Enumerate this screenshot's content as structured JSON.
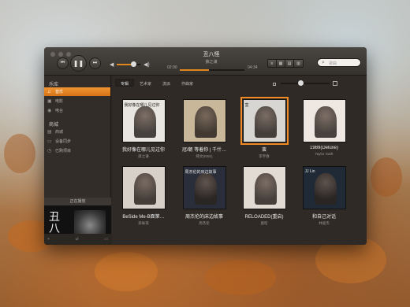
{
  "player": {
    "title": "丑八怪",
    "artist": "薛之谦",
    "time_elapsed": "02:00",
    "time_total": "04:34",
    "progress_fraction": 0.45,
    "volume_fraction": 0.7
  },
  "search": {
    "placeholder": "歌曲"
  },
  "sidebar": {
    "library_header": "乐库",
    "library_items": [
      {
        "label": "音乐",
        "icon": "music-note-icon",
        "active": true
      },
      {
        "label": "电影",
        "icon": "film-icon",
        "active": false
      },
      {
        "label": "电台",
        "icon": "radio-icon",
        "active": false
      }
    ],
    "store_header": "商城",
    "store_items": [
      {
        "label": "商城",
        "icon": "store-icon"
      },
      {
        "label": "设备同步",
        "icon": "device-icon"
      },
      {
        "label": "已购项目",
        "icon": "purchased-icon"
      }
    ],
    "now_playing_header": "正在播放",
    "now_playing_cover_text": "丑八怪"
  },
  "tabs": [
    {
      "label": "专辑",
      "active": true
    },
    {
      "label": "艺术家",
      "active": false
    },
    {
      "label": "流派",
      "active": false
    },
    {
      "label": "作曲家",
      "active": false
    }
  ],
  "albums": [
    {
      "title": "我好像在哪儿见过你",
      "artist": "薛之谦",
      "selected": false,
      "cover_text": "我好像在哪儿见过你",
      "bg": "#e9e6e1"
    },
    {
      "title": "冠/朝 等着你 | 千什…",
      "artist": "韩文(KBS)",
      "selected": false,
      "cover_text": "",
      "bg": "#c9b79a"
    },
    {
      "title": "蛮",
      "artist": "李宇春",
      "selected": true,
      "cover_text": "蛮",
      "bg": "#d8d6d2"
    },
    {
      "title": "1989(Deluxe)",
      "artist": "Taylor Swift",
      "selected": false,
      "cover_text": "",
      "bg": "#efe7e2"
    },
    {
      "title": "BeSide Me-B面第…",
      "artist": "梁咏琪",
      "selected": false,
      "cover_text": "",
      "bg": "#d7d0c8"
    },
    {
      "title": "周杰伦的床边故事",
      "artist": "周杰伦",
      "selected": false,
      "cover_text": "周杰伦的床边故事",
      "bg": "#2a2e3a"
    },
    {
      "title": "RELOADED(重启)",
      "artist": "鹿晗",
      "selected": false,
      "cover_text": "",
      "bg": "#e1dbd4"
    },
    {
      "title": "和自己对话",
      "artist": "林俊杰",
      "selected": false,
      "cover_text": "JJ Lin",
      "bg": "#1f2a36"
    }
  ],
  "colors": {
    "accent": "#f08a24"
  }
}
